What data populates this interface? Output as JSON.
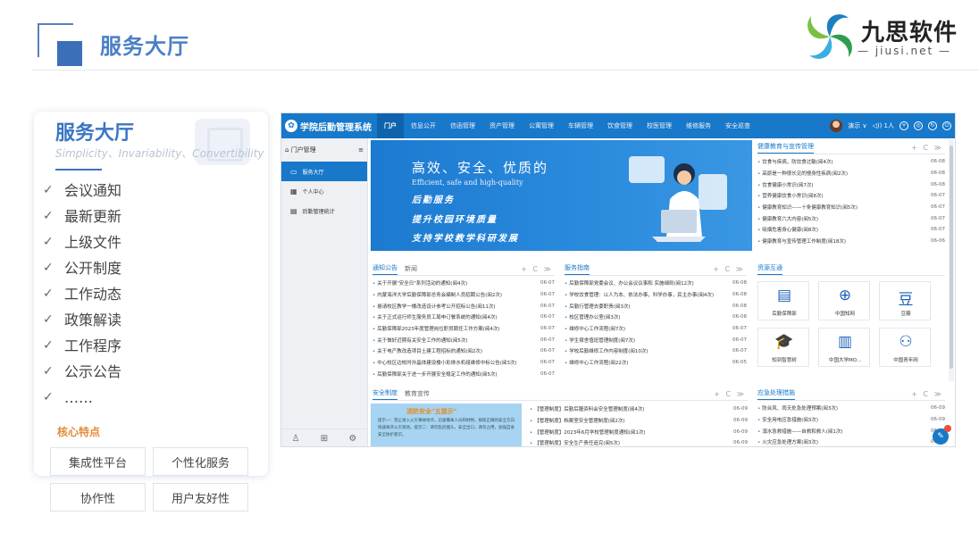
{
  "slide": {
    "title": "服务大厅",
    "brand_name": "九思软件",
    "brand_url": "— jiusi.net —"
  },
  "card": {
    "title": "服务大厅",
    "slogan": "Simplicity、Invariability、Convertibility",
    "features": [
      "会议通知",
      "最新更新",
      "上级文件",
      "公开制度",
      "工作动态",
      "政策解读",
      "工作程序",
      "公示公告",
      "……"
    ],
    "check_glyph": "✓",
    "core_label": "核心特点",
    "tags": [
      "集成性平台",
      "个性化服务",
      "协作性",
      "用户友好性"
    ]
  },
  "app": {
    "system_name": "学院后勤管理系统",
    "nav": [
      "门户",
      "信息公开",
      "信函管理",
      "资产管理",
      "公寓管理",
      "车辆管理",
      "饮食管理",
      "校医管理",
      "维修服务",
      "安全巡查"
    ],
    "user": {
      "name": "演示 ∨",
      "status": "◁)) 1人"
    },
    "sidebar_title": "门户管理",
    "sidebar_items": [
      "服务大厅",
      "个人中心",
      "后勤管理统计"
    ],
    "tools": "+ C ≫",
    "banner": {
      "main": "高效、安全、优质的",
      "en_line1": "Efficient, safe and high-quality",
      "line1": "后勤服务",
      "line2": "提升校园环境质量",
      "line3": "支持学校教学科研发展"
    },
    "health": {
      "title": "健康教育与宣传管理",
      "rows": [
        {
          "t": "饮食与疾病，防饮食过敏(阅4次)",
          "d": "06-08"
        },
        {
          "t": "高原是一种很长见的慢身性疾病(阅2次)",
          "d": "06-08"
        },
        {
          "t": "饮食健康小常识(阅7次)",
          "d": "06-08"
        },
        {
          "t": "营养健康饮食小常识(阅8次)",
          "d": "06-07"
        },
        {
          "t": "健康教育知识——十条健康教育知识(阅5次)",
          "d": "06-07"
        },
        {
          "t": "健康教育六大内容(阅5次)",
          "d": "06-07"
        },
        {
          "t": "吸烟危害身心健康(阅8次)",
          "d": "06-07"
        },
        {
          "t": "健康教育与宣传管理工作制度(阅18次)",
          "d": "06-06"
        }
      ]
    },
    "notice": {
      "tabs": [
        "通知公告",
        "新闻"
      ],
      "rows": [
        {
          "t": "关于开展\"安全日\"系列活动的通知(阅4次)",
          "d": "06-07"
        },
        {
          "t": "内蒙海洋大学后勤保障部总务会编制人员招聘公告(阅2次)",
          "d": "06-07"
        },
        {
          "t": "悬请校区教学一楼改造设计参考公开招标公告(阅11次)",
          "d": "06-07"
        },
        {
          "t": "关于正式运行师生服务员工局申订餐系统的通知(阅4次)",
          "d": "06-07"
        },
        {
          "t": "后勤保障部2023年度管理岗位职员聘任工作方案(阅4次)",
          "d": "06-07"
        },
        {
          "t": "关于做好近期有关安全工作的通知(阅5次)",
          "d": "06-07"
        },
        {
          "t": "关于电产教改造项目土建工程招标的通知(阅2次)",
          "d": "06-07"
        },
        {
          "t": "中心校区边校时孙晶体建设楼小彩排水机组维修中标公告(阅3次)",
          "d": "06-07"
        },
        {
          "t": "后勤保障部关于进一步开展安全稳定工作的通知(阅5次)",
          "d": "06-07"
        }
      ]
    },
    "guide": {
      "title": "服务指南",
      "rows": [
        {
          "t": "后勤保障部党委会议、办公会议议事和 实施细则(阅12次)",
          "d": "06-08"
        },
        {
          "t": "学校饮食管理：以人为本、依法办事，科学办事，民主办事(阅4次)",
          "d": "06-08"
        },
        {
          "t": "后勤行管理去委职责(阅3次)",
          "d": "06-08"
        },
        {
          "t": "校区管理办公室(阅3次)",
          "d": "06-08"
        },
        {
          "t": "维修中心工作流程(阅7次)",
          "d": "06-07"
        },
        {
          "t": "学生宿舍值班管理制度(阅7次)",
          "d": "06-07"
        },
        {
          "t": "学校后勤维修工作内容制度(阅10次)",
          "d": "06-07"
        },
        {
          "t": "维修中心工作流程(阅22次)",
          "d": "06-05"
        }
      ]
    },
    "resources": {
      "title": "资源互通",
      "tiles": [
        {
          "g": "▤",
          "l": "后勤保障部",
          "icon": "document-icon"
        },
        {
          "g": "⊕",
          "l": "中国知网",
          "icon": "globe-icon"
        },
        {
          "g": "豆",
          "l": "豆瓣",
          "icon": "douban-icon"
        },
        {
          "g": "🎓",
          "l": "知到智慧树",
          "icon": "graduation-cap-icon"
        },
        {
          "g": "▥",
          "l": "中国大学MO...",
          "icon": "book-icon"
        },
        {
          "g": "⚇",
          "l": "中国青年网",
          "icon": "people-icon"
        }
      ]
    },
    "safety": {
      "tabs": [
        "安全制度",
        "教育宣传"
      ],
      "img_title": "消防安全\"五提示\"",
      "img_text": "提示一：禁止进入火灾事故地点，迅速撤离人员和财物，按照正确的安全方向快速离开火灾现场。提示二：请勿乱扔烟头，安全出口，请勿占用，加强自身安全防护意识。",
      "rows": [
        {
          "t": "【管理制度】后勤后膳资料会安全管理制度(阅4次)",
          "d": "06-09"
        },
        {
          "t": "【管理制度】档案室安全管理制度(阅2次)",
          "d": "06-09"
        },
        {
          "t": "【管理制度】2023年6月学校管理制度通知(阅1次)",
          "d": "06-09"
        },
        {
          "t": "【管理制度】安全生产责任追究(阅5次)",
          "d": "06-09"
        }
      ]
    },
    "emergency": {
      "title": "应急处理措施",
      "rows": [
        {
          "t": "防台风、雨天处急处理预案(阅3次)",
          "d": "06-09"
        },
        {
          "t": "安全用电应急措施(阅3次)",
          "d": "06-09"
        },
        {
          "t": "溺水急救措施——自救和救人(阅1次)",
          "d": "06-09"
        },
        {
          "t": "火灾应急处理方案(阅3次)",
          "d": "06-09"
        }
      ]
    }
  }
}
